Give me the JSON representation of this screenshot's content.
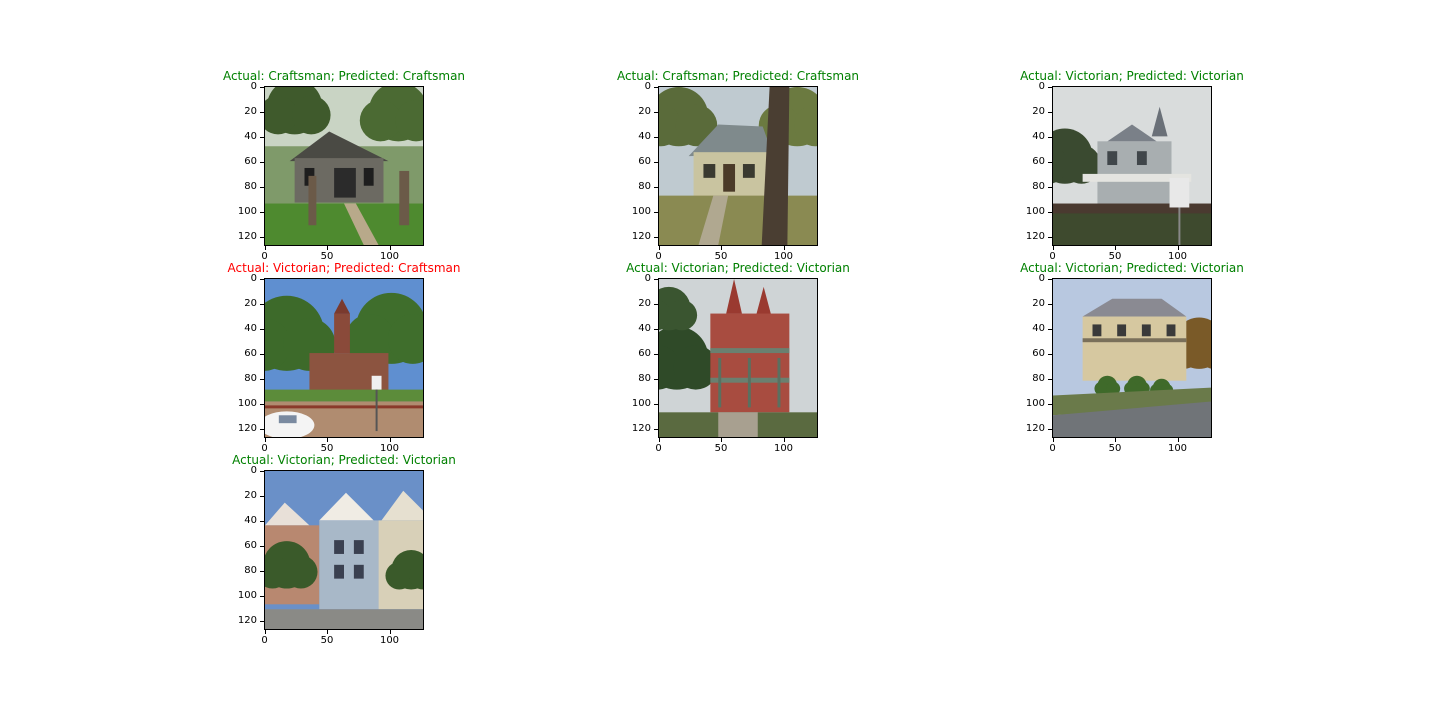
{
  "figure": {
    "colors": {
      "correct": "#008000",
      "incorrect": "#ff0000"
    },
    "axes": {
      "y_ticks": [
        "0",
        "20",
        "40",
        "60",
        "80",
        "100",
        "120"
      ],
      "x_ticks": [
        "0",
        "50",
        "100"
      ]
    },
    "panels": [
      {
        "title": "Actual: Craftsman; Predicted: Craftsman",
        "correct": true,
        "scene": "craftsman-gray-house"
      },
      {
        "title": "Actual: Craftsman; Predicted: Craftsman",
        "correct": true,
        "scene": "craftsman-cottage-with-tree"
      },
      {
        "title": "Actual: Victorian; Predicted: Victorian",
        "correct": true,
        "scene": "victorian-gray-with-turret"
      },
      {
        "title": "Actual: Victorian; Predicted: Craftsman",
        "correct": false,
        "scene": "brick-building-with-tower"
      },
      {
        "title": "Actual: Victorian; Predicted: Victorian",
        "correct": true,
        "scene": "red-victorian-with-spires"
      },
      {
        "title": "Actual: Victorian; Predicted: Victorian",
        "correct": true,
        "scene": "tan-victorian-mansion"
      },
      {
        "title": "Actual: Victorian; Predicted: Victorian",
        "correct": true,
        "scene": "painted-ladies-row"
      }
    ]
  }
}
